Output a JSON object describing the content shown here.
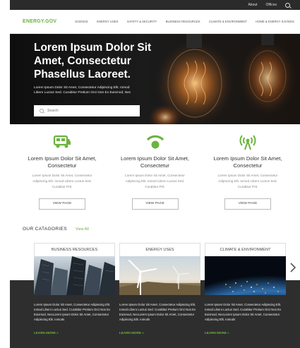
{
  "utility_bar": {
    "about": "About",
    "offices": "Offices"
  },
  "nav": {
    "logo": "ENERGY.GOV",
    "items": [
      "SCIENCE",
      "ENERGY USES",
      "SAFETY & SECURITY",
      "BUSINESS RESOURCES",
      "CLIMATE & ENVIRONMENT",
      "HOME & ENERGY SAVINGS"
    ]
  },
  "hero": {
    "title": "Lorem Ipsum Dolor Sit Amet, Consectetur Phasellus Laoreet.",
    "subtitle": "Lorem Ipsum Dolor Sit Amet, Consectetur Adipiscing Elit. Iomod Libero Luctus Sed. Curabitur Pretium Orci Non Ex Euismod, Nec",
    "search_placeholder": "Search"
  },
  "features": [
    {
      "icon": "vehicle-icon",
      "title": "Lorem Ipsum Dolor Sit Amet, Consectetur",
      "text": "Lorem Ipsum Dolor Sit Amet, Consectetur Adipiscing Elit. Iomod Libero Luctus Sed. Curabitur Prtl.",
      "button": "VIEW PAGE"
    },
    {
      "icon": "wifi-icon",
      "title": "Lorem Ipsum Dolor Sit Amet, Consectetur",
      "text": "Lorem Ipsum Dolor Sit Amet, Consectetur Adipiscing Elit. Iomod Libero Luctus Sed. Curabitur Prtl.",
      "button": "VIEW PAGE"
    },
    {
      "icon": "broadcast-tower-icon",
      "title": "Lorem Ipsum Dolor Sit Amet, Consectetur",
      "text": "Lorem Ipsum Dolor Sit Amet, Consectetur Adipiscing Elit. Iomod Libero Luctus Sed. Curabitur Prtl.",
      "button": "VIEW PAGE"
    }
  ],
  "categories": {
    "title": "OUR CATAGORIES",
    "view_all": "View All",
    "cards": [
      {
        "title": "BUSINESS RESOURCES",
        "text": "Lorem Ipsum Dolor Sit Amet, Consectetur Adipiscing Elit. Iomod Libero Luctus Sed. Curabitur Pretium Orci Non Ex Euismod, NecLorem Ipsum Dolor Sit Amet, Consectetur Adipiscing Elit. Iomods",
        "more": "LEARN MORE"
      },
      {
        "title": "ENERGY USES",
        "text": "Lorem Ipsum Dolor Sit Amet, Consectetur Adipiscing Elit. Iomod Libero Luctus Sed. Curabitur Pretium Orci Non Ex Euismod, NecLorem Ipsum Dolor Sit Amet, Consectetur Adipiscing Elit. Iomods",
        "more": "LEARN MORE"
      },
      {
        "title": "CLIMATE & ENVIRONMENT",
        "text": "Lorem Ipsum Dolor Sit Amet, Consectetur Adipiscing Elit. Iomod Libero Luctus Sed. Curabitur Pretium Orci Non Ex Euismod, NecLorem Ipsum Dolor Sit Amet, Consectetur Adipiscing Elit. Iomods",
        "more": "LEARN MORE"
      }
    ]
  },
  "colors": {
    "accent": "#6db33f",
    "dark_band": "#2e2e2e",
    "top_bar": "#2b2b2b"
  }
}
